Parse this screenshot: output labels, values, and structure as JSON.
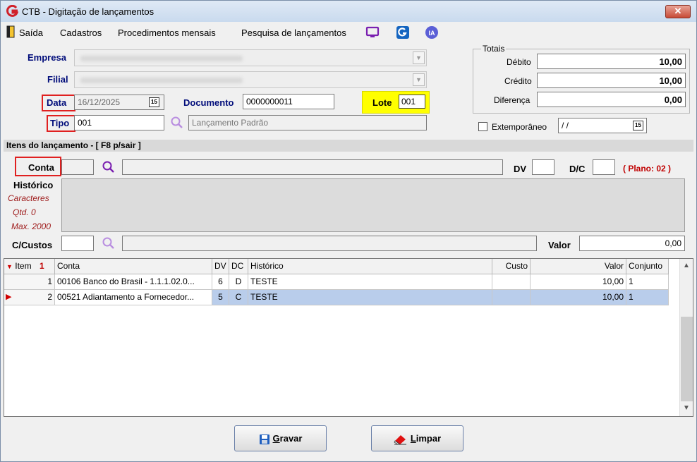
{
  "window": {
    "title": "CTB - Digitação de lançamentos",
    "close_label": "✕"
  },
  "menu": {
    "items": [
      "Saída",
      "Cadastros",
      "Procedimentos mensais",
      "Pesquisa de lançamentos"
    ]
  },
  "form": {
    "empresa_label": "Empresa",
    "filial_label": "Filial",
    "data_label": "Data",
    "data_value": "16/12/2025",
    "documento_label": "Documento",
    "documento_value": "0000000011",
    "lote_label": "Lote",
    "lote_value": "001",
    "tipo_label": "Tipo",
    "tipo_value": "001",
    "tipo_desc": "Lançamento Padrão",
    "calendar_icon_text": "15"
  },
  "totais": {
    "title": "Totais",
    "debito_label": "Débito",
    "debito_value": "10,00",
    "credito_label": "Crédito",
    "credito_value": "10,00",
    "diferenca_label": "Diferença",
    "diferenca_value": "0,00",
    "extemporaneo_label": "Extemporâneo",
    "extemporaneo_value": " / /"
  },
  "itens": {
    "section_title": "Itens do lançamento - [ F8 p/sair ]",
    "conta_label": "Conta",
    "dv_label": "DV",
    "dc_label": "D/C",
    "plano_label": "( Plano: 02 )",
    "historico_label": "Histórico",
    "caracteres_label": "Caracteres",
    "qtd_label": "Qtd. 0",
    "max_label": "Max. 2000",
    "ccustos_label": "C/Custos",
    "valor_label": "Valor",
    "valor_value": "0,00"
  },
  "grid": {
    "headers": {
      "item": "Item",
      "sort": "1",
      "conta": "Conta",
      "dv": "DV",
      "dc": "DC",
      "historico": "Histórico",
      "custo": "Custo",
      "valor": "Valor",
      "conjunto": "Conjunto"
    },
    "rows": [
      {
        "item": "1",
        "conta": "00106 Banco do Brasil - 1.1.1.02.0...",
        "dv": "6",
        "dc": "D",
        "historico": "TESTE",
        "custo": "",
        "valor": "10,00",
        "conjunto": "1"
      },
      {
        "item": "2",
        "conta": "00521 Adiantamento a Fornecedor...",
        "dv": "5",
        "dc": "C",
        "historico": "TESTE",
        "custo": "",
        "valor": "10,00",
        "conjunto": "1"
      }
    ]
  },
  "buttons": {
    "gravar_underline": "G",
    "gravar_rest": "ravar",
    "limpar_underline": "L",
    "limpar_rest": "impar"
  },
  "colors": {
    "accent_label": "#000c7a",
    "highlight_red": "#e02020",
    "lote_yellow": "#ffff00",
    "selected_row": "#b9cdeb"
  }
}
